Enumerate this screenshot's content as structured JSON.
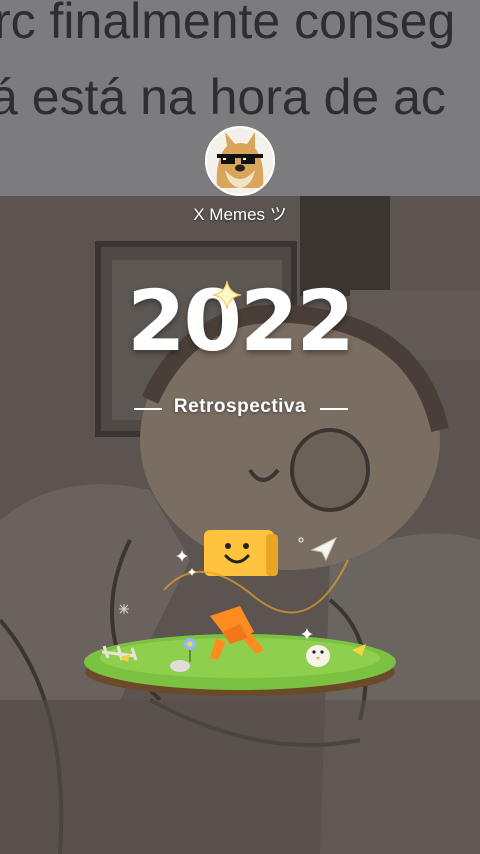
{
  "background": {
    "top_text_line1": "rc finalmente conseg",
    "top_text_line2": "á está na hora de ac",
    "colors": {
      "overlay": "#5a5450",
      "text_band": "#7c7c7e"
    }
  },
  "profile": {
    "avatar_icon": "doge-with-sunglasses-icon",
    "username": "X Memes ツ"
  },
  "title": {
    "year": "2022",
    "subtitle": "Retrospectiva"
  },
  "illustration": {
    "icons": [
      "smiley-box-character-icon",
      "grass-island-icon",
      "paper-plane-icon",
      "sparkle-icon",
      "chick-icon",
      "flower-icon"
    ]
  }
}
